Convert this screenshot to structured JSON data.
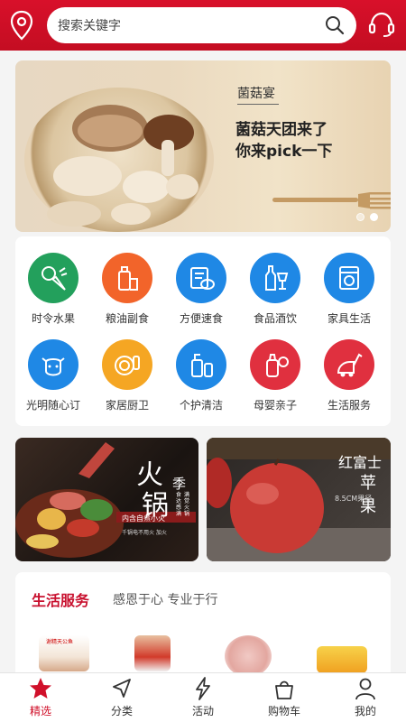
{
  "header": {
    "search_placeholder": "搜索关键字",
    "icons": [
      "location-pin-icon",
      "search-icon",
      "customer-service-icon"
    ],
    "accent": "#d0102a"
  },
  "banner": {
    "tag": "菌菇宴",
    "title_line1": "菌菇天团来了",
    "title_line2": "你来pick一下",
    "pages": 2,
    "active_page": 2
  },
  "categories": [
    {
      "label": "时令水果",
      "icon": "fruit-veg-icon",
      "color": "#23a05c"
    },
    {
      "label": "粮油副食",
      "icon": "grain-oil-icon",
      "color": "#f2642a"
    },
    {
      "label": "方便速食",
      "icon": "instant-food-icon",
      "color": "#1f88e5"
    },
    {
      "label": "食品酒饮",
      "icon": "drinks-icon",
      "color": "#1f88e5"
    },
    {
      "label": "家具生活",
      "icon": "washing-machine-icon",
      "color": "#1f88e5"
    },
    {
      "label": "光明随心订",
      "icon": "cow-icon",
      "color": "#1f88e5"
    },
    {
      "label": "家居厨卫",
      "icon": "cleaning-plate-icon",
      "color": "#f5a623"
    },
    {
      "label": "个护清洁",
      "icon": "bottles-icon",
      "color": "#1f88e5"
    },
    {
      "label": "母婴亲子",
      "icon": "baby-bottle-icon",
      "color": "#e0303f"
    },
    {
      "label": "生活服务",
      "icon": "vacuum-icon",
      "color": "#e0303f"
    }
  ],
  "promos": {
    "hotpot": {
      "big1": "火",
      "big2": "锅",
      "small": "季",
      "v1": "食达感满",
      "v2": "满觉火锅",
      "red_line": "内含自煮小火",
      "bottom": "千锅电不用火 加火"
    },
    "apple": {
      "title1": "红富士",
      "title2": "苹果",
      "size": "8.5CM果径"
    }
  },
  "life_services": {
    "title": "生活服务",
    "subtitle": "感恩于心 专业于行",
    "product_label": "谢精天公鱼"
  },
  "tabs": [
    {
      "label": "精选",
      "icon": "star-icon",
      "active": true
    },
    {
      "label": "分类",
      "icon": "compass-arrow-icon",
      "active": false
    },
    {
      "label": "活动",
      "icon": "lightning-icon",
      "active": false
    },
    {
      "label": "购物车",
      "icon": "cart-basket-icon",
      "active": false
    },
    {
      "label": "我的",
      "icon": "person-icon",
      "active": false
    }
  ]
}
